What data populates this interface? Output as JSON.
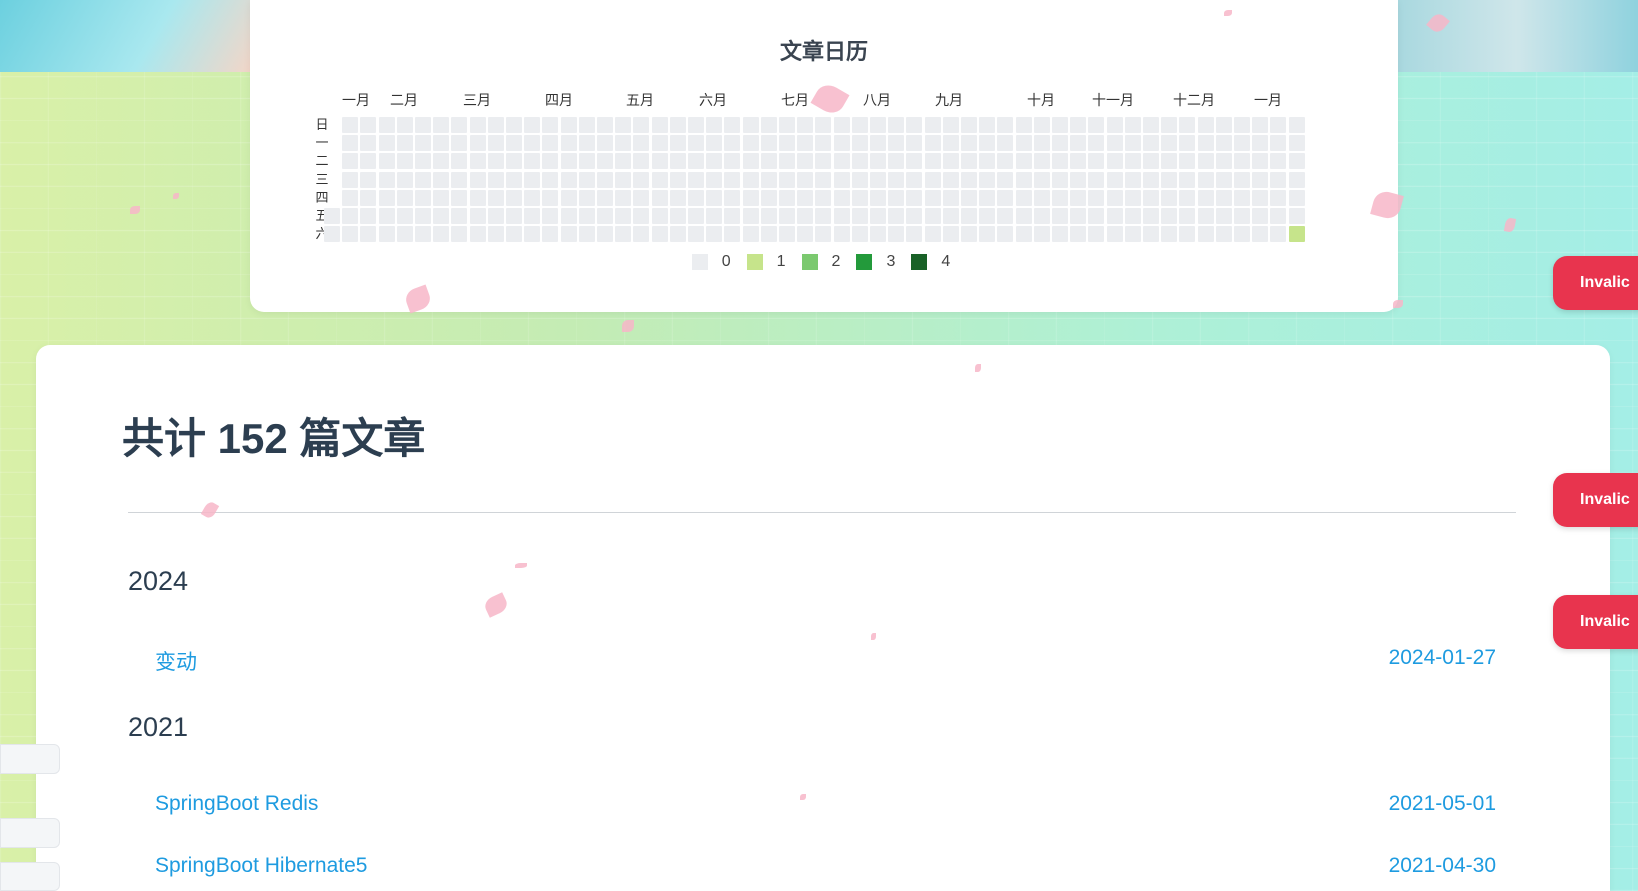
{
  "calendar": {
    "title": "文章日历",
    "months": [
      "一月",
      "二月",
      "三月",
      "四月",
      "五月",
      "六月",
      "七月",
      "八月",
      "九月",
      "十月",
      "十一月",
      "十二月",
      "一月"
    ],
    "weekdays": [
      "日",
      "一",
      "二",
      "三",
      "四",
      "五",
      "六"
    ],
    "legend": [
      {
        "label": "0",
        "color": "#ebedf0"
      },
      {
        "label": "1",
        "color": "#c6e48b"
      },
      {
        "label": "2",
        "color": "#7bc96f"
      },
      {
        "label": "3",
        "color": "#239a3b"
      },
      {
        "label": "4",
        "color": "#196127"
      }
    ],
    "active_cells": [
      {
        "week": 53,
        "day": 6,
        "level": 1
      }
    ]
  },
  "archive": {
    "total_title": "共计 152 篇文章",
    "groups": [
      {
        "year": "2024",
        "posts": [
          {
            "title": "变动",
            "date": "2024-01-27"
          }
        ]
      },
      {
        "year": "2021",
        "posts": [
          {
            "title": "SpringBoot Redis",
            "date": "2021-05-01"
          },
          {
            "title": "SpringBoot Hibernate5",
            "date": "2021-04-30"
          }
        ]
      }
    ]
  },
  "side_buttons": [
    "Invalic",
    "Invalic",
    "Invalic"
  ]
}
